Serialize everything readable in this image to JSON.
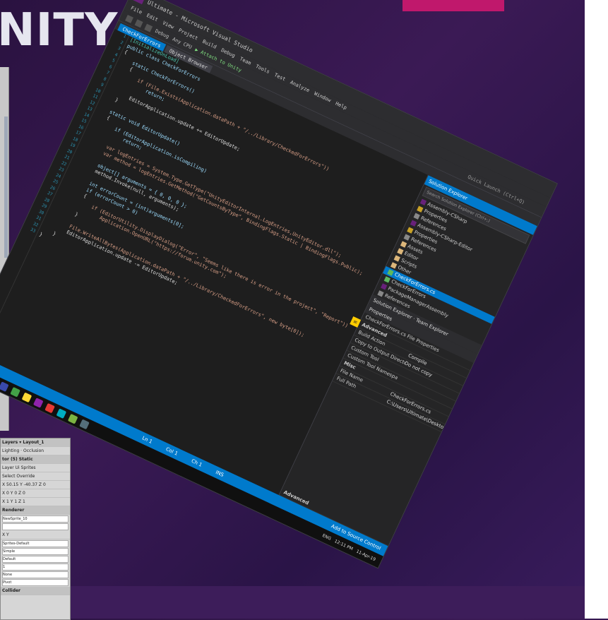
{
  "slide": {
    "title": "NITY",
    "accent_color": "#c0186c"
  },
  "inspector": {
    "toolbar_left": "▾",
    "layers": "Layers",
    "layout": "Layout_1",
    "tab_lighting": "Lighting",
    "tab_occlusion": "Occlusion",
    "component": "tor (5)",
    "static": "Static",
    "tag_row": "Layer  Ui Sprites",
    "select_row": "Select   Override",
    "pos": "X 50.15  Y -40.37  Z 0",
    "rot": "X 0  Y 0  Z 0",
    "scale": "X 1  Y 1  Z 1",
    "renderer": "Renderer",
    "sprite": "NewSprite_10",
    "flip": "X  Y",
    "material": "Sprites-Default",
    "draw_mode": "Simple",
    "sort": "Default",
    "order": "1",
    "mask": "None",
    "cull": "Pivot",
    "collider": "Collider"
  },
  "vs": {
    "title": "Ultimate - Microsoft Visual Studio",
    "menu": [
      "File",
      "Edit",
      "View",
      "Project",
      "Build",
      "Debug",
      "Team",
      "Tools",
      "Test",
      "Analyze",
      "Window",
      "Help"
    ],
    "toolbar": {
      "config": "Debug",
      "platform": "Any CPU",
      "start": "▶ Attach to Unity"
    },
    "tabs": [
      "CheckForErrors",
      "Object Browser"
    ],
    "sub_tab": "EditorCheck",
    "search_hint": "Quick Launch (Ctrl+Q)",
    "scope_left": "Assembly-CSharp-Editor",
    "scope_right": "CheckForErrors()",
    "code_lines": [
      "[InitializeOnLoad]",
      "public class CheckForErrors",
      "{",
      "    static CheckForErrors()",
      "    {",
      "        if (File.Exists(Application.dataPath + \"/../Library/CheckedForErrors\"))",
      "            return;",
      "",
      "        EditorApplication.update += EditorUpdate;",
      "    }",
      "",
      "    static void EditorUpdate()",
      "    {",
      "        if (EditorApplication.isCompiling)",
      "            return;",
      "",
      "        var logEntries = System.Type.GetType(\"UnityEditorInternal.LogEntries,UnityEditor.dll\");",
      "        var method = logEntries.GetMethod(\"GetCountsByType\", BindingFlags.Static | BindingFlags.Public);",
      "",
      "        object[] arguments = { 0, 0, 0 };",
      "        method.Invoke(null, arguments);",
      "",
      "        int errorCount = (int)arguments[0];",
      "        if (errorCount > 0)",
      "        {",
      "            if (EditorUtility.DisplayDialog(\"Error\", \"Seems like there is error in the project\", \"Report\"))",
      "                Application.OpenURL(\"https://forum.unity.com\");",
      "        }",
      "",
      "        File.WriteAllBytes(Application.dataPath + \"/../Library/CheckedForErrors\", new byte[0]);",
      "        EditorApplication.update -= EditorUpdate;",
      "    }",
      "}"
    ],
    "solution_explorer": {
      "title": "Solution Explorer",
      "search": "Search Solution Explorer (Ctrl+;)",
      "items": [
        {
          "label": "Assembly-CSharp",
          "selected": false
        },
        {
          "label": "Properties",
          "selected": false
        },
        {
          "label": "References",
          "selected": false
        },
        {
          "label": "Assembly-CSharp-Editor",
          "selected": false
        },
        {
          "label": "Properties",
          "selected": false
        },
        {
          "label": "References",
          "selected": false
        },
        {
          "label": "Assets",
          "selected": false
        },
        {
          "label": "Editor",
          "selected": false
        },
        {
          "label": "Scripts",
          "selected": false
        },
        {
          "label": "Other",
          "selected": false
        },
        {
          "label": "CheckForErrors.cs",
          "selected": true
        },
        {
          "label": "CheckForErrors",
          "selected": false
        },
        {
          "label": "PackageManagerAssembly",
          "selected": false
        },
        {
          "label": "References",
          "selected": false
        }
      ],
      "tab_solution": "Solution Explorer",
      "tab_team": "Team Explorer"
    },
    "properties": {
      "title": "Properties",
      "subject": "CheckForErrors.cs  File Properties",
      "section_advanced": "Advanced",
      "rows": [
        {
          "key": "Build Action",
          "value": "Compile"
        },
        {
          "key": "Copy to Output Directory",
          "value": "Do not copy"
        },
        {
          "key": "Custom Tool",
          "value": ""
        },
        {
          "key": "Custom Tool Namespace",
          "value": ""
        }
      ],
      "section_misc": "Misc",
      "misc_rows": [
        {
          "key": "File Name",
          "value": "CheckForErrors.cs"
        },
        {
          "key": "Full Path",
          "value": "C:\\Users\\Ultimate\\Desktop\\..."
        }
      ],
      "footer": "Advanced"
    },
    "status": {
      "ln": "Ln 1",
      "col": "Col 1",
      "ch": "Ch 1",
      "ins": "INS",
      "publish": "Add to Source Control"
    },
    "tray": {
      "lang": "ENG",
      "time": "12:11 PM",
      "date": "11-Apr-19"
    }
  },
  "taskbar_colors": [
    "#1e88e5",
    "#3949ab",
    "#e53935",
    "#43a047",
    "#fb8c00",
    "#8e24aa",
    "#00897b",
    "#c62828",
    "#6d4c41",
    "#1e88e5",
    "#3949ab",
    "#43a047",
    "#fdd835",
    "#8e24aa",
    "#e53935",
    "#00acc1",
    "#7cb342",
    "#546e7a"
  ]
}
